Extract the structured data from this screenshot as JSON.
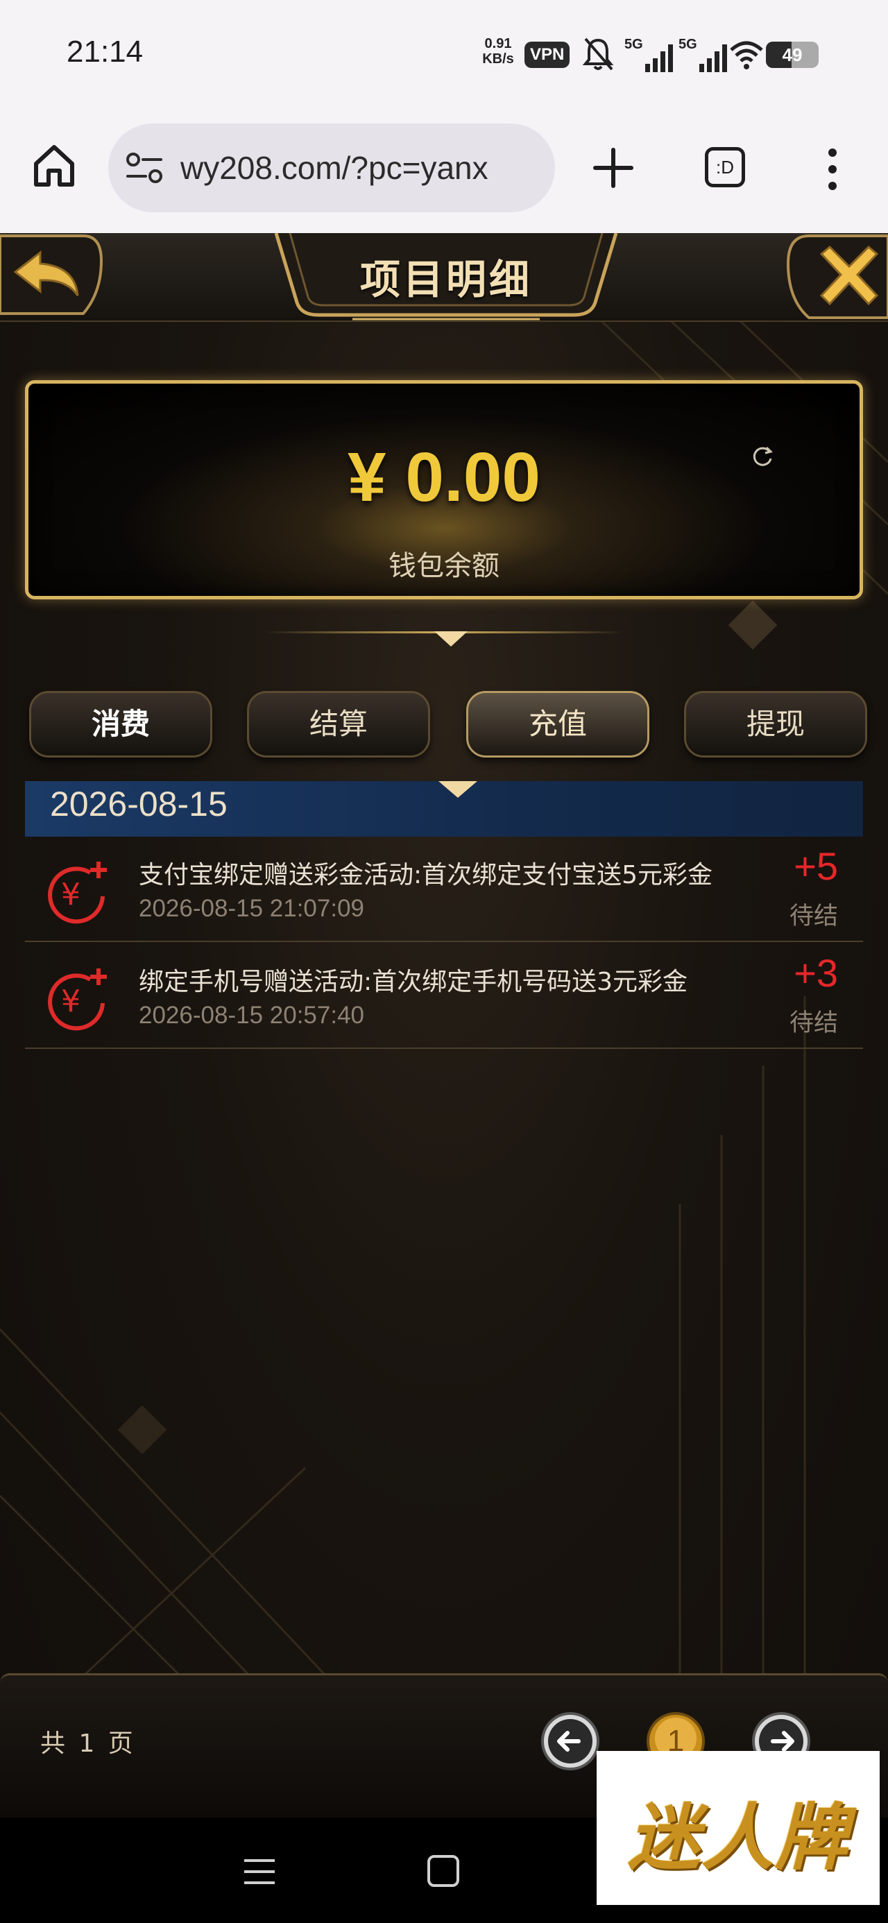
{
  "status_bar": {
    "time": "21:14",
    "net_speed_value": "0.91",
    "net_speed_unit": "KB/s",
    "vpn_label": "VPN",
    "signal_1_label": "5G",
    "signal_2_label": "5G",
    "battery_level": "49",
    "battery_fraction": 0.49
  },
  "browser": {
    "url": "wy208.com/?pc=yanx",
    "tabs_label": ":D"
  },
  "page": {
    "title": "项目明细",
    "balance_amount": "¥ 0.00",
    "balance_label": "钱包余额",
    "accent_gold": "#d7b460",
    "amount_red": "#e8262a",
    "tabs": [
      {
        "label": "消费",
        "active": false
      },
      {
        "label": "结算",
        "active": false
      },
      {
        "label": "充值",
        "active": true
      },
      {
        "label": "提现",
        "active": false
      }
    ],
    "date_group": "2026-08-15",
    "records": [
      {
        "title": "支付宝绑定赠送彩金活动:首次绑定支付宝送5元彩金",
        "time": "2026-08-15 21:07:09",
        "amount": "+5",
        "status": "待结"
      },
      {
        "title": "绑定手机号赠送活动:首次绑定手机号码送3元彩金",
        "time": "2026-08-15 20:57:40",
        "amount": "+3",
        "status": "待结"
      }
    ],
    "footer": {
      "page_count_label": "共 1 页",
      "current_page": "1"
    }
  },
  "watermark": {
    "text": "迷人牌"
  },
  "icons": {
    "back": "back-arrow-icon",
    "close": "close-x-icon",
    "refresh": "refresh-icon",
    "record": "yuan-plus-icon",
    "prev": "arrow-left-icon",
    "next": "arrow-right-icon"
  }
}
